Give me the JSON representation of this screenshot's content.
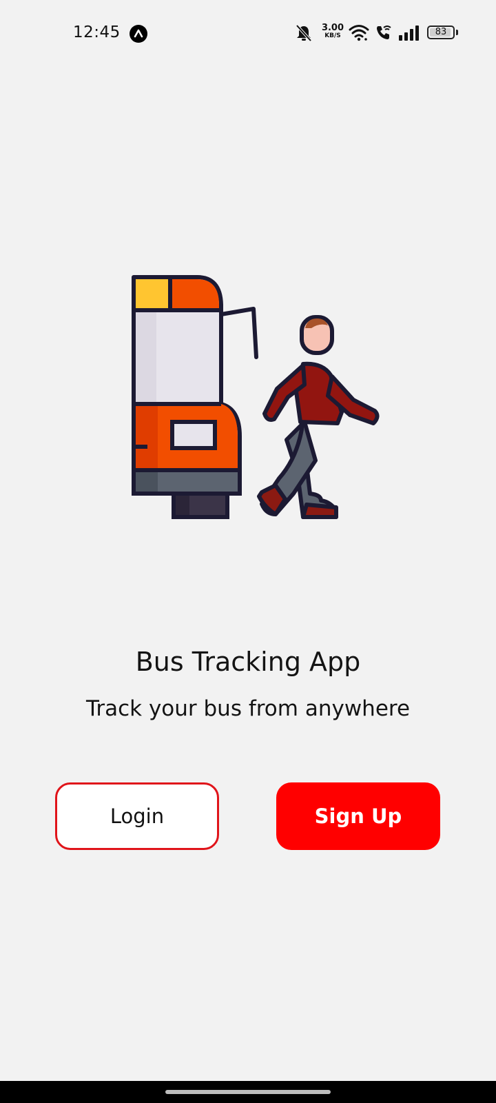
{
  "status_bar": {
    "time": "12:45",
    "app_icon": "a-logo-icon",
    "net_speed_value": "3.00",
    "net_speed_unit": "KB/S",
    "battery_level": "83",
    "icons": [
      "mute-bell-icon",
      "wifi-icon",
      "wifi-call-icon",
      "signal-bars-icon",
      "battery-icon"
    ]
  },
  "illustration": {
    "icon": "bus-and-walking-person-icon"
  },
  "main": {
    "title": "Bus Tracking App",
    "subtitle": "Track your bus from anywhere"
  },
  "actions": {
    "login_label": "Login",
    "signup_label": "Sign Up"
  },
  "colors": {
    "accent": "#ff0000",
    "login_border": "#e0141a",
    "background": "#f2f2f2"
  }
}
